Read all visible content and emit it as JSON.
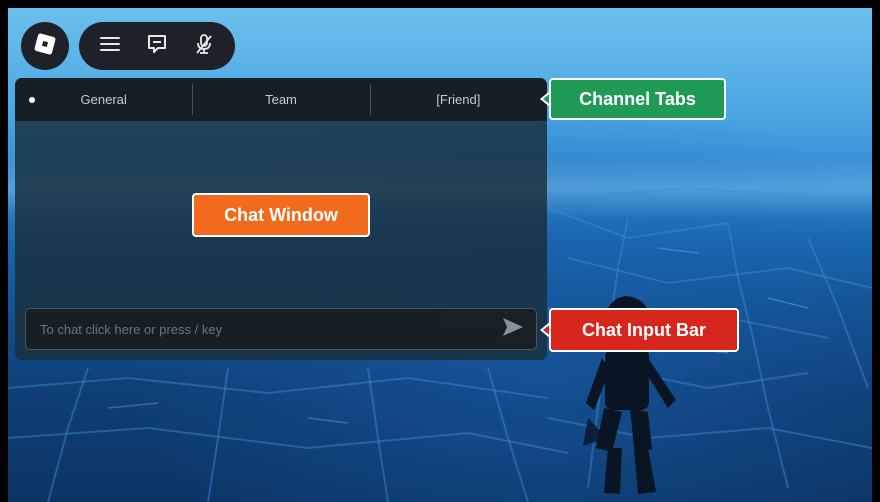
{
  "toolbar": {
    "roblox_icon": "roblox-logo-icon",
    "menu_icon": "hamburger-menu-icon",
    "chat_icon": "chat-bubble-icon",
    "mic_icon": "microphone-muted-icon"
  },
  "chat": {
    "tabs": [
      {
        "label": "General",
        "active": true
      },
      {
        "label": "Team",
        "active": false
      },
      {
        "label": "[Friend]",
        "active": false
      }
    ],
    "input_placeholder": "To chat click here or press / key",
    "send_icon": "send-arrow-icon"
  },
  "callouts": {
    "channel_tabs": "Channel Tabs",
    "chat_window": "Chat Window",
    "chat_input_bar": "Chat Input Bar"
  },
  "colors": {
    "callout_green": "#1f9b57",
    "callout_orange": "#f26a1b",
    "callout_red": "#d7261c",
    "panel_dark": "#1e2128"
  }
}
